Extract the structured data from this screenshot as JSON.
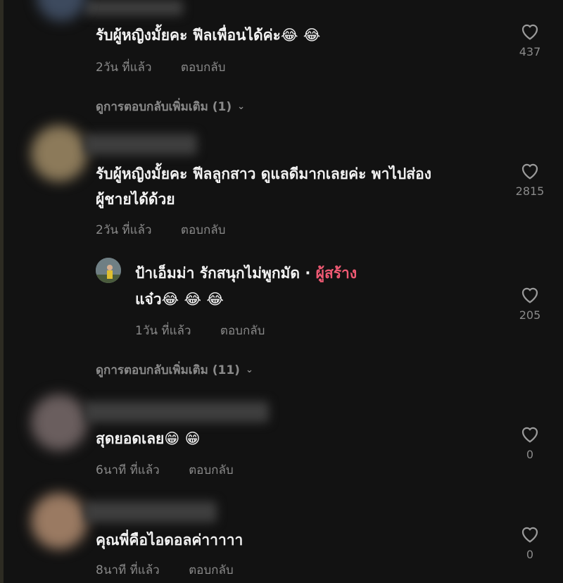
{
  "comments": [
    {
      "text": "รับผู้หญิงมั้ยคะ ฟีลเพื่อนได้ค่ะ😂 😂",
      "time": "2วัน ที่แล้ว",
      "reply": "ตอบกลับ",
      "likes": "437",
      "more_replies": "ดูการตอบกลับเพิ่มเติม (1)"
    },
    {
      "text_line1": "รับผู้หญิงมั้ยคะ ฟีลลูกสาว ดูแลดีมากเลยค่ะ พาไปส่อง",
      "text_line2": "ผู้ชายได้ด้วย",
      "time": "2วัน ที่แล้ว",
      "reply": "ตอบกลับ",
      "likes": "2815"
    },
    {
      "author": "ป้าเอ็มม่า รักสนุกไม่พูกมัด",
      "separator": " · ",
      "creator_label": "ผู้สร้าง",
      "text": "แจ๋ว😂 😂 😂",
      "time": "1วัน ที่แล้ว",
      "reply": "ตอบกลับ",
      "likes": "205",
      "more_replies": "ดูการตอบกลับเพิ่มเติม (11)"
    },
    {
      "text": "สุดยอดเลย😁 😁",
      "time": "6นาที ที่แล้ว",
      "reply": "ตอบกลับ",
      "likes": "0"
    },
    {
      "text": "คุณพี่คือไอดอลค่าาาาา",
      "time": "8นาที ที่แล้ว",
      "reply": "ตอบกลับ",
      "likes": "0"
    }
  ],
  "icons": {
    "like": "heart-icon",
    "expand": "chevron-down-icon"
  },
  "colors": {
    "background": "#121212",
    "creator_tag": "#f05a74",
    "muted": "#8a8a8a"
  }
}
